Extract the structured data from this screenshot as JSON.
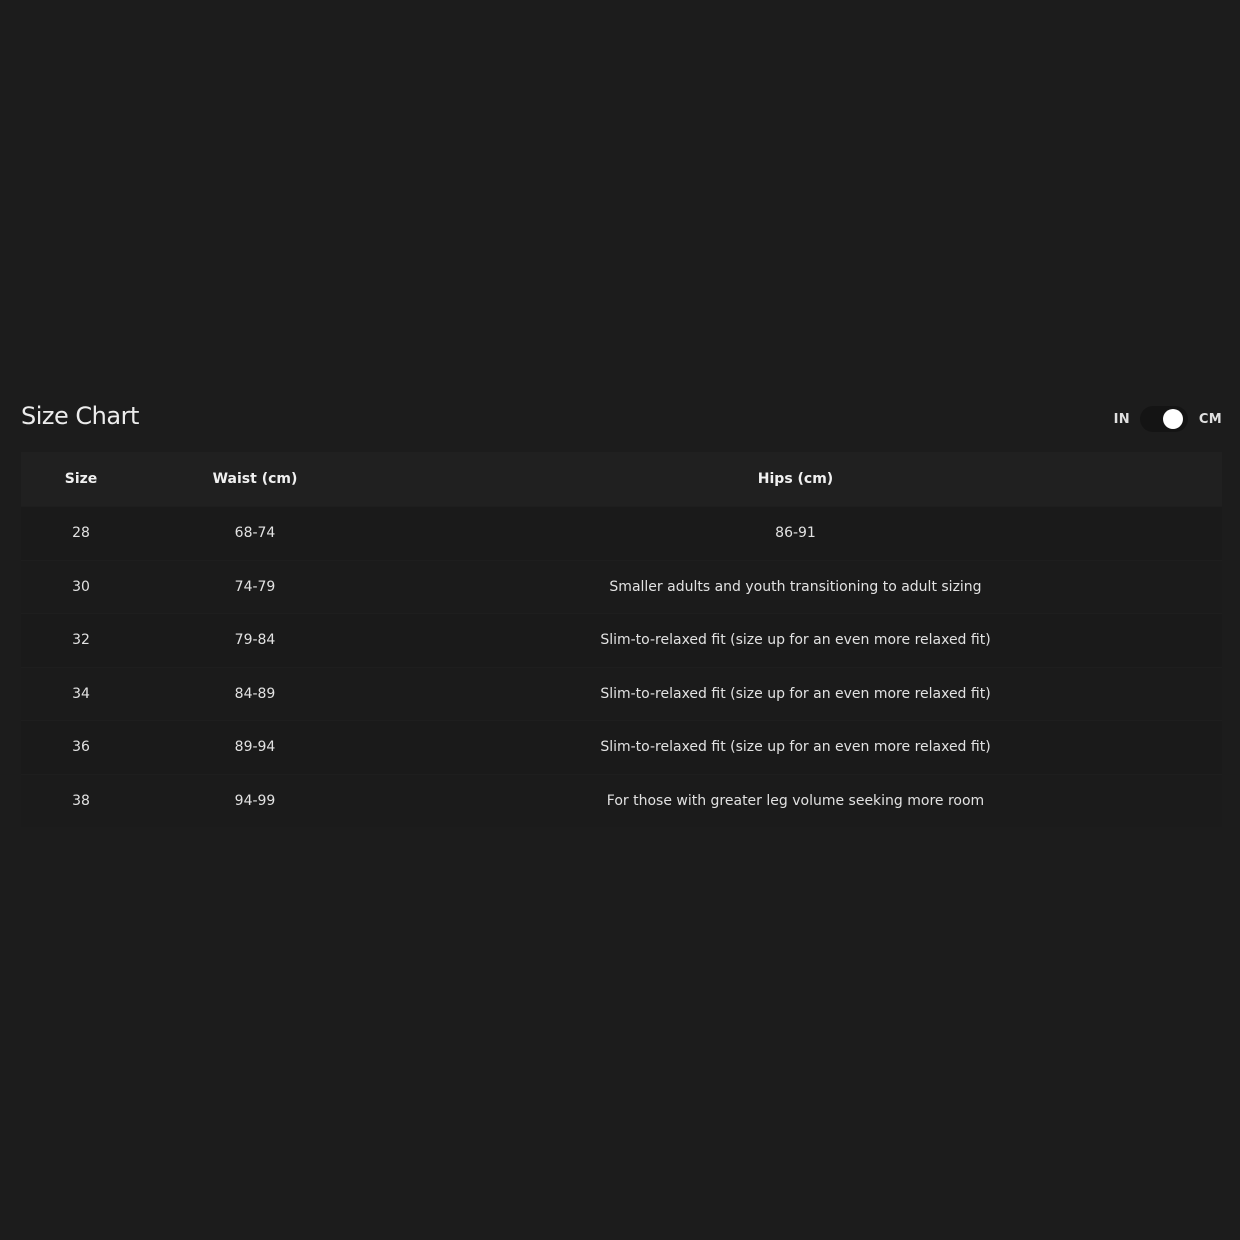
{
  "title": "Size Chart",
  "unit_toggle": {
    "left_label": "IN",
    "right_label": "CM",
    "selected": "CM"
  },
  "table": {
    "headers": [
      "Size",
      "Waist (cm)",
      "Hips (cm)"
    ],
    "rows": [
      [
        "28",
        "68-74",
        "86-91"
      ],
      [
        "30",
        "74-79",
        "Smaller adults and youth transitioning to adult sizing"
      ],
      [
        "32",
        "79-84",
        "Slim-to-relaxed fit (size up for an even more relaxed fit)"
      ],
      [
        "34",
        "84-89",
        "Slim-to-relaxed fit (size up for an even more relaxed fit)"
      ],
      [
        "36",
        "89-94",
        "Slim-to-relaxed fit (size up for an even more relaxed fit)"
      ],
      [
        "38",
        "94-99",
        "For those with greater leg volume seeking more room"
      ]
    ]
  }
}
